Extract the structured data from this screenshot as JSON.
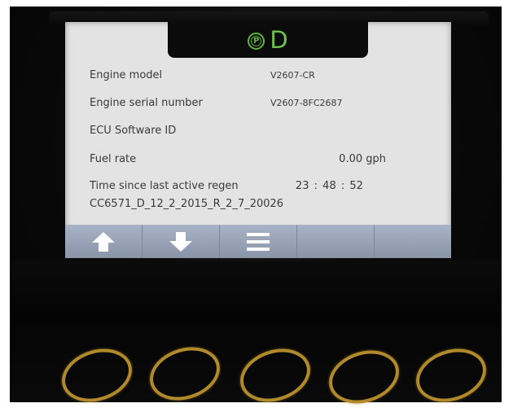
{
  "header": {
    "park_symbol": "P",
    "gear": "D"
  },
  "rows": [
    {
      "label": "Engine model",
      "value": "V2607-CR"
    },
    {
      "label": "Engine serial number",
      "value": "V2607-8FC2687"
    },
    {
      "label": "ECU Software ID",
      "value": ""
    },
    {
      "label": "Fuel rate",
      "value": "0.00 gph"
    },
    {
      "label": "Time since last active regen",
      "value": "23 :  48 :  52"
    }
  ],
  "software_id_value": "CC6571_D_12_2_2015_R_2_7_20026",
  "toolbar": {
    "buttons": [
      "up-arrow-icon",
      "down-arrow-icon",
      "menu-icon",
      "",
      ""
    ]
  },
  "colors": {
    "screen_bg": "#e4e3e4",
    "gear_green": "#6fc24a",
    "toolbar": "#9aa4b8",
    "ring_amber": "#b28a2c"
  }
}
